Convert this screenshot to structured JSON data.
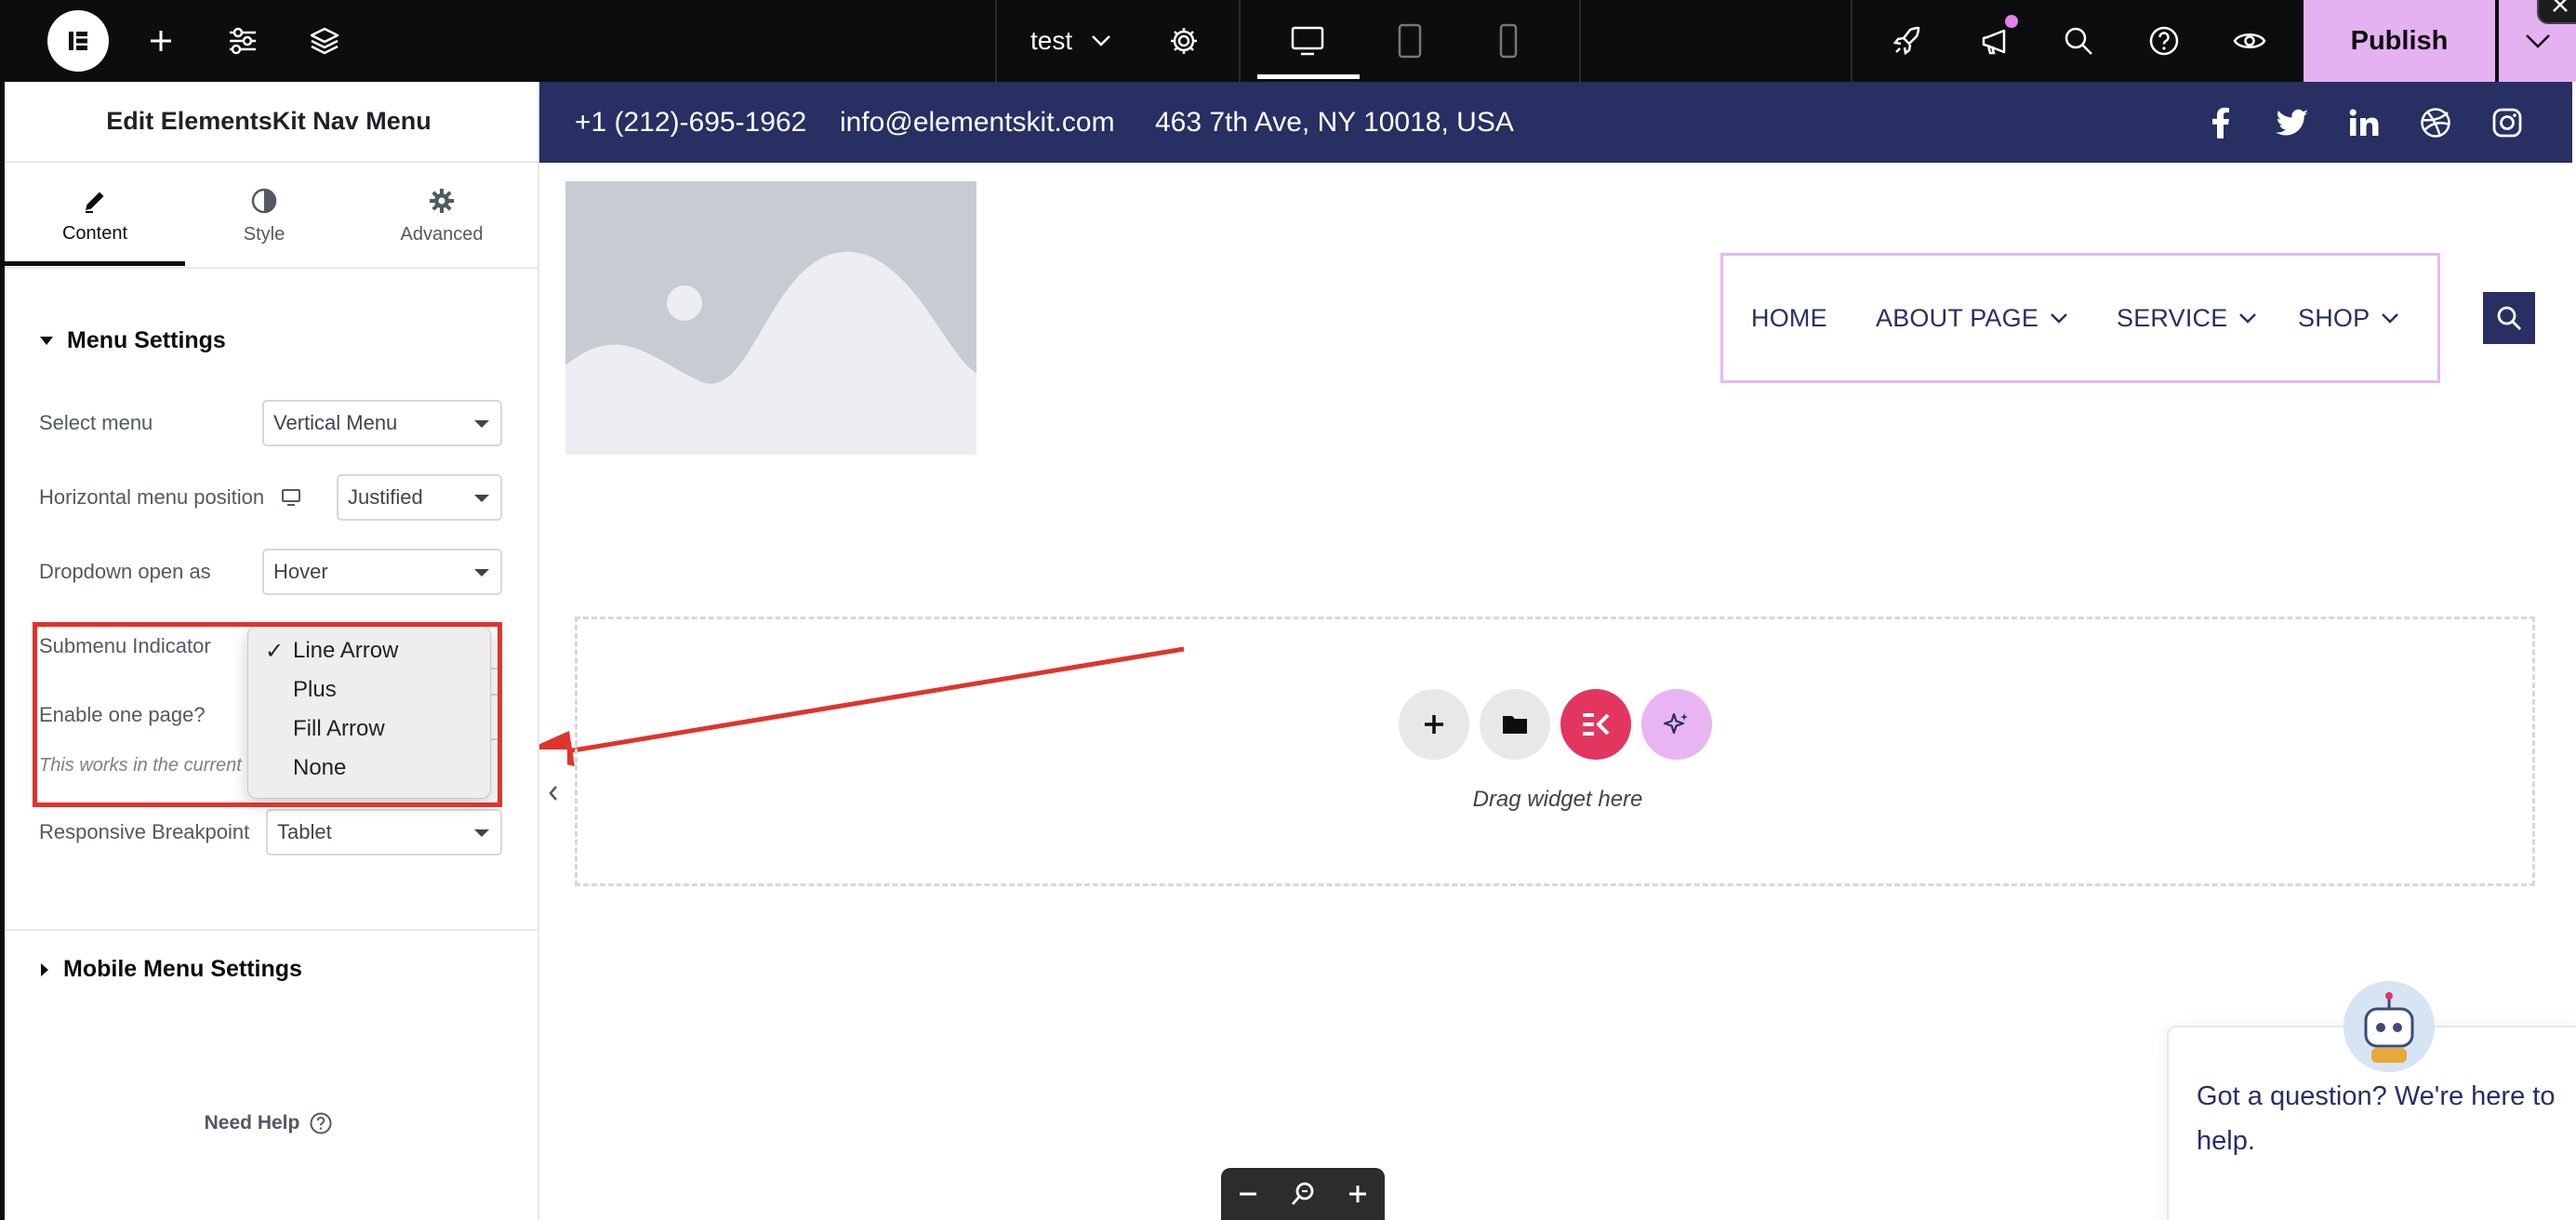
{
  "topbar": {
    "document_title": "test",
    "publish_label": "Publish",
    "colors": {
      "background": "#0c0d0e",
      "publish": "#e5b1f0"
    }
  },
  "panel": {
    "title": "Edit ElementsKit Nav Menu",
    "tabs": [
      {
        "label": "Content",
        "icon": "pencil-icon",
        "active": true
      },
      {
        "label": "Style",
        "icon": "half-circle-icon",
        "active": false
      },
      {
        "label": "Advanced",
        "icon": "gear-icon",
        "active": false
      }
    ],
    "menu_settings": {
      "title": "Menu Settings",
      "select_menu": {
        "label": "Select menu",
        "value": "Vertical Menu"
      },
      "horizontal_position": {
        "label": "Horizontal menu position",
        "value": "Justified"
      },
      "dropdown_open": {
        "label": "Dropdown open as",
        "value": "Hover"
      },
      "submenu_indicator": {
        "label": "Submenu Indicator",
        "options": [
          "Line Arrow",
          "Plus",
          "Fill Arrow",
          "None"
        ],
        "selected": "Line Arrow"
      },
      "one_page": {
        "label": "Enable one page?",
        "hint": "This works in the current"
      },
      "responsive_breakpoint": {
        "label": "Responsive Breakpoint",
        "value": "Tablet"
      }
    },
    "mobile_settings": {
      "title": "Mobile Menu Settings"
    },
    "need_help": "Need Help"
  },
  "canvas": {
    "topinfo": {
      "phone": "+1 (212)-695-1962",
      "email": "info@elementskit.com",
      "address": "463 7th Ave, NY 10018, USA",
      "socials": [
        "facebook-icon",
        "twitter-icon",
        "linkedin-icon",
        "dribbble-icon",
        "instagram-icon"
      ],
      "background": "#272f63"
    },
    "nav": {
      "items": [
        {
          "label": "HOME",
          "dropdown": false
        },
        {
          "label": "ABOUT PAGE",
          "dropdown": true
        },
        {
          "label": "SERVICE",
          "dropdown": true
        },
        {
          "label": "SHOP",
          "dropdown": true
        }
      ]
    },
    "dropzone_label": "Drag widget here",
    "chat": {
      "message": "Got a question? We're here to help."
    }
  }
}
